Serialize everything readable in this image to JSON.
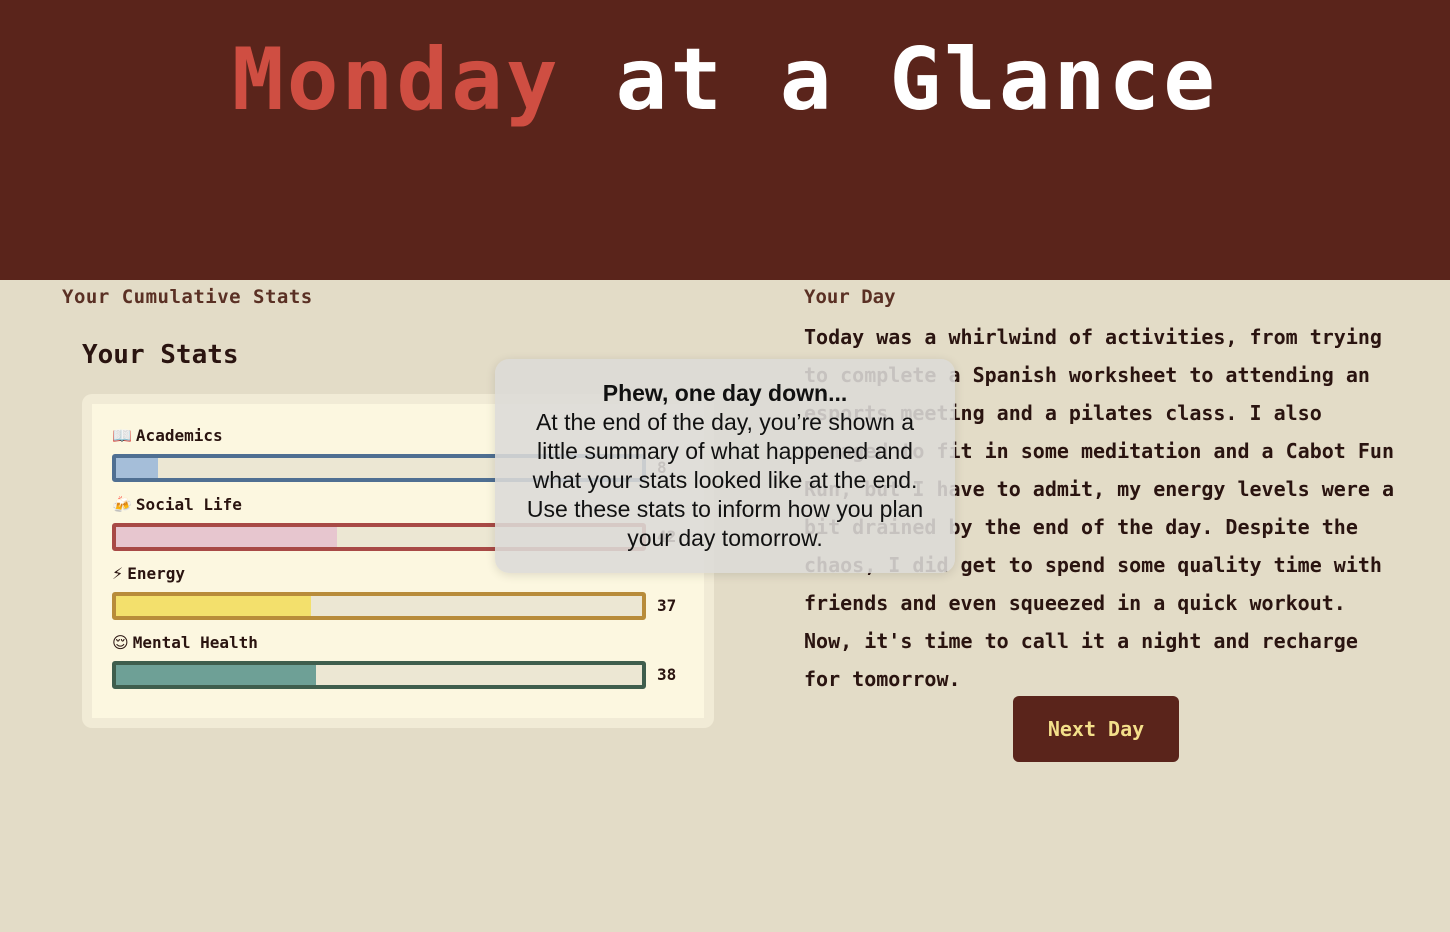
{
  "header": {
    "title_day": "Monday",
    "title_rest": "at a Glance"
  },
  "left": {
    "heading": "Your Cumulative Stats",
    "stats_title": "Your Stats",
    "stats": [
      {
        "label": "Academics",
        "emoji": "📖",
        "value": "8",
        "percent": 8,
        "fill_color": "#a5bed9",
        "border_color": "#4f6f92"
      },
      {
        "label": "Social Life",
        "emoji": "🍻",
        "value": "42",
        "percent": 42,
        "fill_color": "#e7c6cf",
        "border_color": "#a84a46"
      },
      {
        "label": "Energy",
        "emoji": "⚡",
        "value": "37",
        "percent": 37,
        "fill_color": "#f3e06c",
        "border_color": "#b88c3a"
      },
      {
        "label": "Mental Health",
        "emoji": "😌",
        "value": "38",
        "percent": 38,
        "fill_color": "#6ea096",
        "border_color": "#3f5e4d"
      }
    ]
  },
  "right": {
    "heading": "Your Day",
    "story": "Today was a whirlwind of activities, from trying to complete a Spanish worksheet to attending an esports meeting and a pilates class. I also managed to fit in some meditation and a Cabot Fun Run, but I have to admit, my energy levels were a bit drained by the end of the day. Despite the chaos, I did get to spend some quality time with friends and even squeezed in a quick workout. Now, it's time to call it a night and recharge for tomorrow.",
    "next_button": "Next Day"
  },
  "tooltip": {
    "title": "Phew, one day down...",
    "body": "At the end of the day, you’re shown a little summary of what happened and what your stats looked like at the end. Use these stats to inform how you plan your day tomorrow."
  }
}
